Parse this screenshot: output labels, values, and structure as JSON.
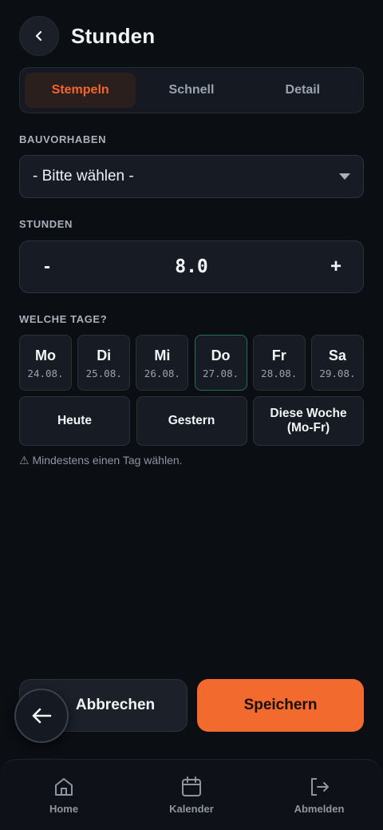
{
  "header": {
    "title": "Stunden"
  },
  "tabs": [
    "Stempeln",
    "Schnell",
    "Detail"
  ],
  "project": {
    "label": "BAUVORHABEN",
    "value": "- Bitte wählen -"
  },
  "hours": {
    "label": "STUNDEN",
    "minus": "-",
    "plus": "+",
    "value": "8.0"
  },
  "days": {
    "label": "WELCHE TAGE?",
    "items": [
      {
        "name": "Mo",
        "date": "24.08."
      },
      {
        "name": "Di",
        "date": "25.08."
      },
      {
        "name": "Mi",
        "date": "26.08."
      },
      {
        "name": "Do",
        "date": "27.08."
      },
      {
        "name": "Fr",
        "date": "28.08."
      },
      {
        "name": "Sa",
        "date": "29.08."
      }
    ],
    "quick": [
      "Heute",
      "Gestern",
      "Diese Woche (Mo-Fr)"
    ],
    "hint": "⚠ Mindestens einen Tag wählen."
  },
  "actions": {
    "cancel": "Abbrechen",
    "save": "Speichern"
  },
  "nav": [
    {
      "label": "Home",
      "icon": "home-icon"
    },
    {
      "label": "Kalender",
      "icon": "calendar-icon"
    },
    {
      "label": "Abmelden",
      "icon": "logout-icon"
    }
  ],
  "colors": {
    "accent": "#f26a2e",
    "today_border": "#1f6e5e",
    "background": "#0b0e13"
  }
}
